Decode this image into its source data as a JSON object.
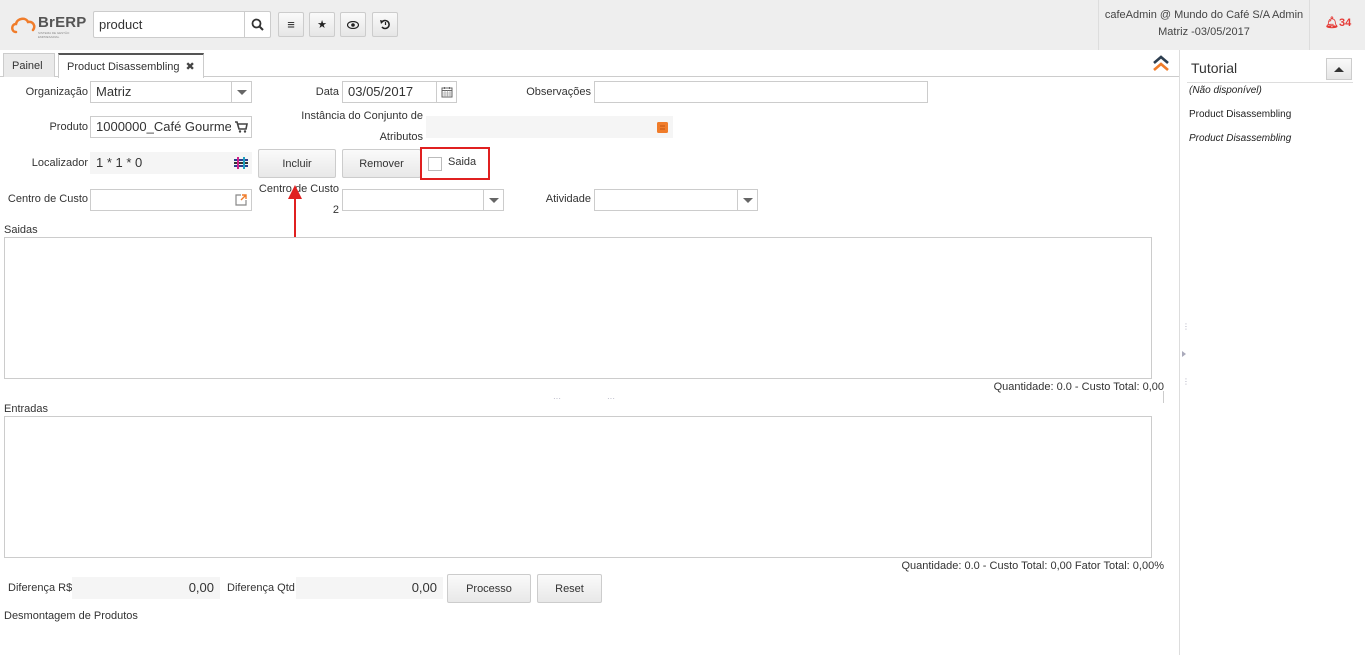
{
  "app": {
    "logo_text": "BrERP",
    "logo_sub": "SISTEMA DE GESTÃO EMPRESARIAL"
  },
  "header": {
    "search_value": "product",
    "search_placeholder": "",
    "user_line1": "cafeAdmin @ Mundo do Café S/A Admin",
    "user_line2": "Matriz -03/05/2017",
    "notification_count": "34",
    "toolbar_icons": [
      "menu-icon",
      "star-icon",
      "eye-icon",
      "history-icon"
    ]
  },
  "tabs": [
    {
      "label": "Painel",
      "active": false
    },
    {
      "label": "Product Disassembling",
      "active": true,
      "close": "✖"
    }
  ],
  "form": {
    "organizacao": {
      "label": "Organização",
      "value": "Matriz"
    },
    "data": {
      "label": "Data",
      "value": "03/05/2017"
    },
    "observacoes": {
      "label": "Observações",
      "value": ""
    },
    "produto": {
      "label": "Produto",
      "value": "1000000_Café Gourmet"
    },
    "instancia": {
      "label_line1": "Instância do Conjunto de",
      "label_line2": "Atributos",
      "value": ""
    },
    "localizador": {
      "label": "Localizador",
      "value": "1 * 1 * 0"
    },
    "incluir_label": "Incluir",
    "remover_label": "Remover",
    "saida": {
      "label": "Saida",
      "checked": false
    },
    "centro_custo": {
      "label": "Centro de Custo",
      "value": ""
    },
    "centro_custo2": {
      "label_line1": "Centro de Custo",
      "label_line2": "2",
      "value": ""
    },
    "atividade": {
      "label": "Atividade",
      "value": ""
    }
  },
  "saidas": {
    "title": "Saidas",
    "summary": "Quantidade: 0.0 - Custo Total: 0,00"
  },
  "entradas": {
    "title": "Entradas",
    "summary": "Quantidade: 0.0 - Custo Total: 0,00 Fator Total: 0,00%"
  },
  "footer": {
    "diferenca_rs_label": "Diferença R$",
    "diferenca_rs_value": "0,00",
    "diferenca_qtd_label": "Diferença Qtd",
    "diferenca_qtd_value": "0,00",
    "processo_label": "Processo",
    "reset_label": "Reset",
    "description": "Desmontagem de Produtos"
  },
  "tutorial": {
    "title": "Tutorial",
    "not_available": "(Não disponível)",
    "item_bold": "Product Disassembling",
    "item_italic": "Product Disassembling"
  },
  "colors": {
    "accent_orange": "#f07c2a",
    "highlight_red": "#e02020",
    "notification_red": "#e53935"
  }
}
